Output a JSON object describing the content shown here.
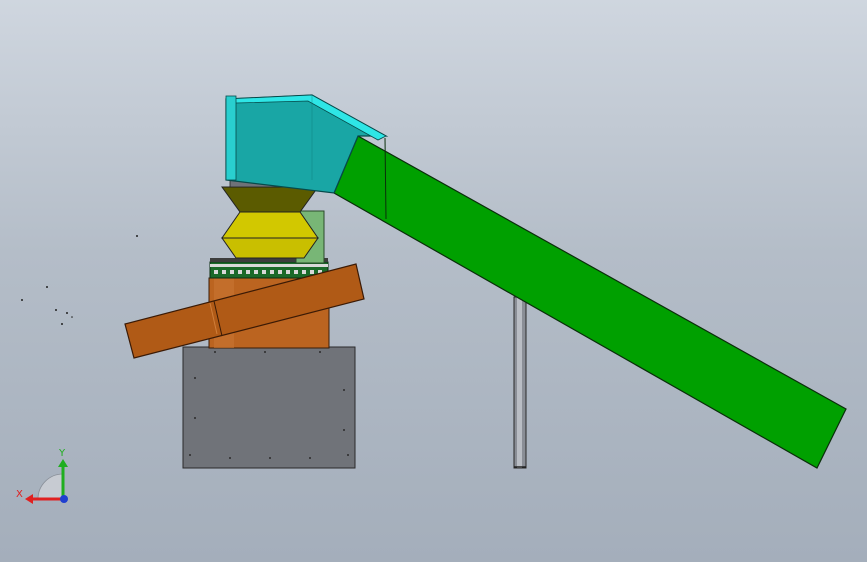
{
  "triad": {
    "x_label": "X",
    "y_label": "Y",
    "x_color": "#e02020",
    "y_color": "#1fae1f",
    "z_color": "#1f3fd0"
  },
  "colors": {
    "background_top": "#cfd6df",
    "background_bottom": "#a4aebb",
    "hood": "#1aa9a6",
    "hood_top": "#27d7d7",
    "conveyor": "#00a000",
    "hopper": "#c8c000",
    "drum": "#b8601a",
    "base": "#6b6e74",
    "leg": "#7c8088"
  }
}
